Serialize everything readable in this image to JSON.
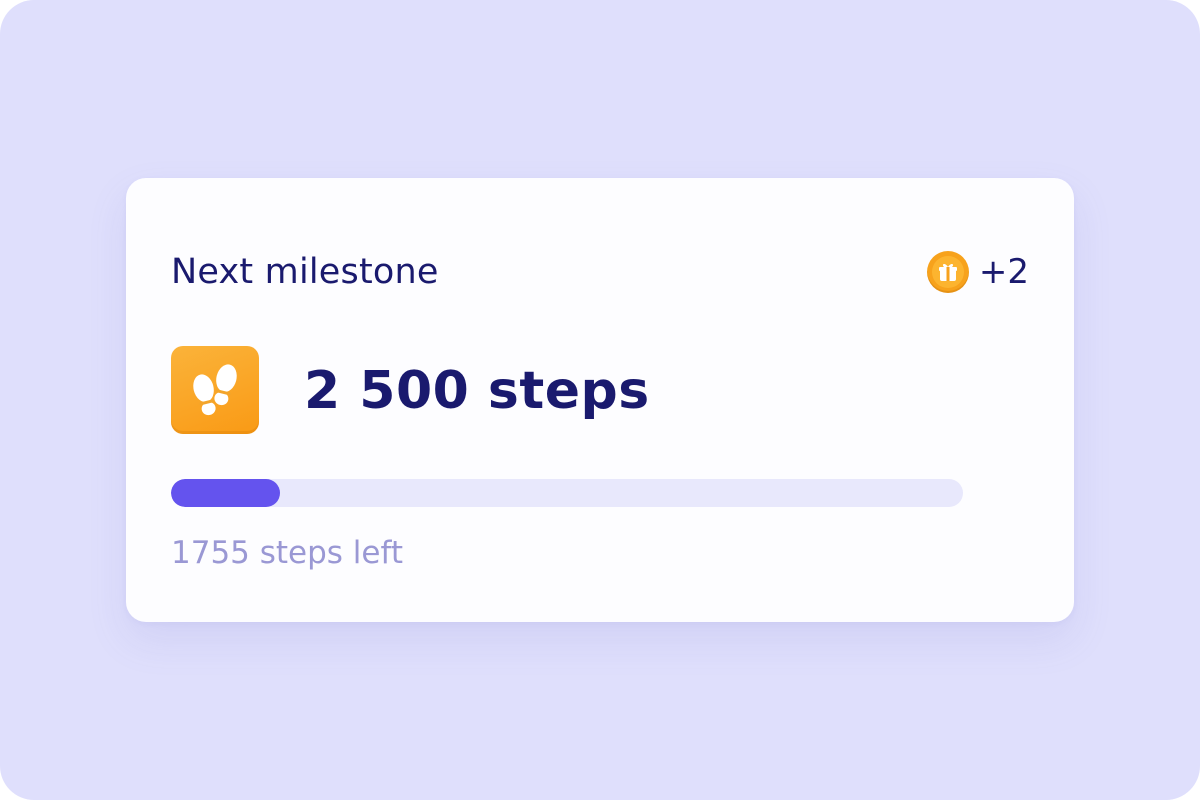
{
  "milestone_card": {
    "title": "Next milestone",
    "reward": {
      "icon": "gift-coin-icon",
      "value": "+2"
    },
    "milestone": {
      "icon": "footprints-icon",
      "value": "2 500 steps"
    },
    "progress": {
      "fraction": 0.138
    },
    "remaining_text": "1755 steps left"
  },
  "colors": {
    "background": "#dfdffc",
    "card": "#fdfdff",
    "title_text": "#1a1a6e",
    "accent_fill": "#6453ee",
    "track": "#e8e8fc",
    "muted_text": "#9a98d4",
    "orange": "#f99a15"
  }
}
